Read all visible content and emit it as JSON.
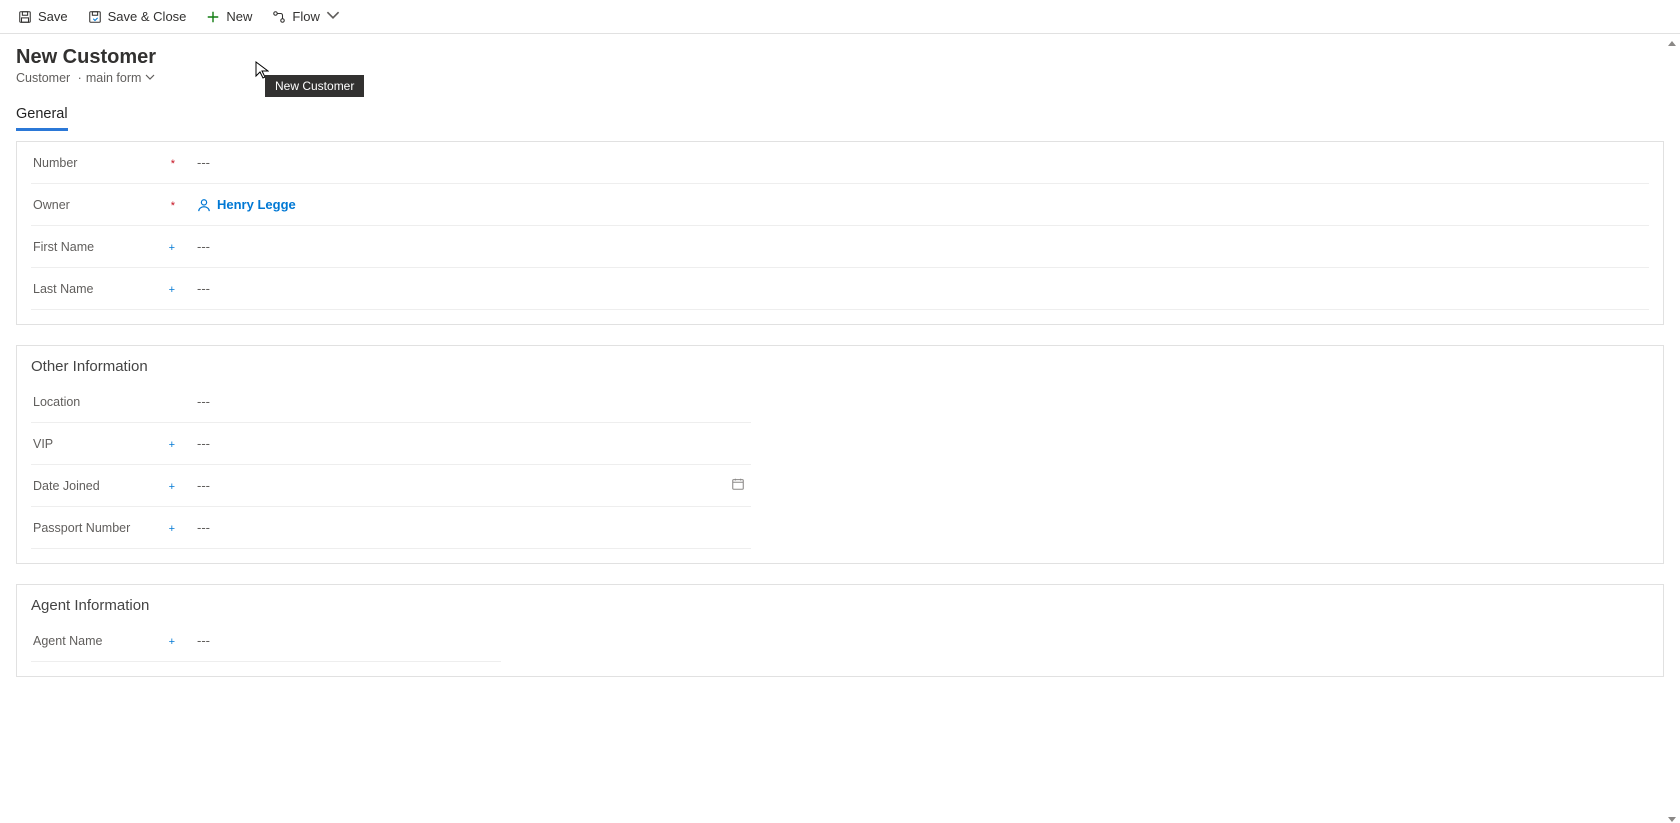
{
  "toolbar": {
    "save": "Save",
    "save_close": "Save & Close",
    "new": "New",
    "flow": "Flow"
  },
  "header": {
    "title": "New Customer",
    "entity": "Customer",
    "form_name": "main form"
  },
  "tooltip": {
    "text": "New Customer"
  },
  "tabs": {
    "general": "General"
  },
  "section_general": {
    "fields": {
      "number": {
        "label": "Number",
        "required": true,
        "recommended": false,
        "value": "---"
      },
      "owner": {
        "label": "Owner",
        "required": true,
        "recommended": false,
        "value": "Henry Legge"
      },
      "first": {
        "label": "First Name",
        "required": false,
        "recommended": true,
        "value": "---"
      },
      "last": {
        "label": "Last Name",
        "required": false,
        "recommended": true,
        "value": "---"
      }
    }
  },
  "section_other": {
    "title": "Other Information",
    "fields": {
      "location": {
        "label": "Location",
        "required": false,
        "recommended": false,
        "value": "---"
      },
      "vip": {
        "label": "VIP",
        "required": false,
        "recommended": true,
        "value": "---"
      },
      "joined": {
        "label": "Date Joined",
        "required": false,
        "recommended": true,
        "value": "---"
      },
      "passport": {
        "label": "Passport Number",
        "required": false,
        "recommended": true,
        "value": "---"
      }
    }
  },
  "section_agent": {
    "title": "Agent Information",
    "fields": {
      "agent": {
        "label": "Agent Name",
        "required": false,
        "recommended": true,
        "value": "---"
      }
    }
  }
}
